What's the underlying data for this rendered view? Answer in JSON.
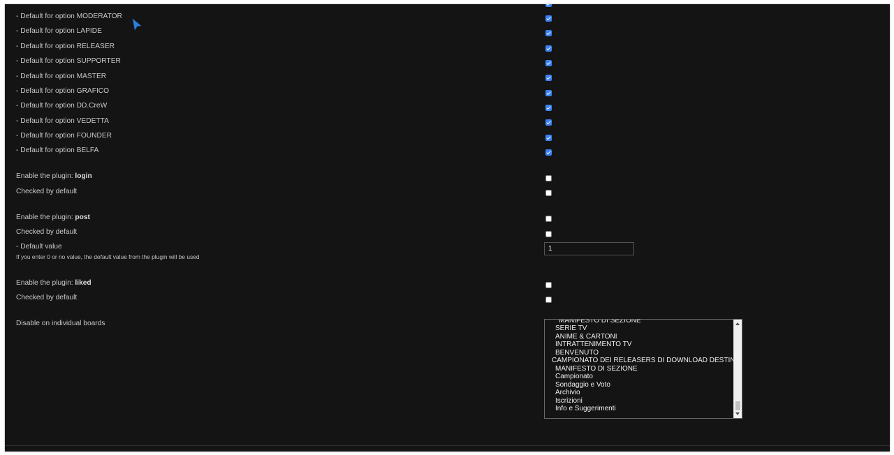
{
  "cursor_icon": "mouse-pointer-icon",
  "group_options": [
    {
      "label": "- Default for option MODERATOR",
      "checked": true
    },
    {
      "label": "- Default for option LAPIDE",
      "checked": true
    },
    {
      "label": "- Default for option RELEASER",
      "checked": true
    },
    {
      "label": "- Default for option SUPPORTER",
      "checked": true
    },
    {
      "label": "- Default for option MASTER",
      "checked": true
    },
    {
      "label": "- Default for option GRAFICO",
      "checked": true
    },
    {
      "label": "- Default for option DD.CreW",
      "checked": true
    },
    {
      "label": "- Default for option VEDETTA",
      "checked": true
    },
    {
      "label": "- Default for option FOUNDER",
      "checked": true
    },
    {
      "label": "- Default for option BELFA",
      "checked": true
    }
  ],
  "plugin_login": {
    "enable_prefix": "Enable the plugin: ",
    "name": "login",
    "enabled": false,
    "checked_label": "Checked by default",
    "checked_default": false
  },
  "plugin_post": {
    "enable_prefix": "Enable the plugin: ",
    "name": "post",
    "enabled": false,
    "checked_label": "Checked by default",
    "checked_default": false,
    "default_value_label": "- Default value",
    "default_value_hint": "If you enter 0 or no value, the default value from the plugin will be used",
    "default_value": "1"
  },
  "plugin_liked": {
    "enable_prefix": "Enable the plugin: ",
    "name": "liked",
    "enabled": false,
    "checked_label": "Checked by default",
    "checked_default": false
  },
  "disable_boards": {
    "label": "Disable on individual boards",
    "options": [
      {
        "text": "MANIFESTO DI SEZIONE",
        "level": "sub"
      },
      {
        "text": "SERIE TV",
        "level": "sub"
      },
      {
        "text": "ANIME & CARTONI",
        "level": "sub"
      },
      {
        "text": "INTRATTENIMENTO TV",
        "level": "sub"
      },
      {
        "text": "BENVENUTO",
        "level": "sub"
      },
      {
        "text": "CAMPIONATO DEI RELEASERS DI DOWNLOAD DESTINAT",
        "level": "cat"
      },
      {
        "text": "MANIFESTO DI SEZIONE",
        "level": "sub"
      },
      {
        "text": "Campionato",
        "level": "sub"
      },
      {
        "text": "Sondaggio e Voto",
        "level": "sub"
      },
      {
        "text": "Archivio",
        "level": "sub"
      },
      {
        "text": "Iscrizioni",
        "level": "sub"
      },
      {
        "text": "Info e Suggerimenti",
        "level": "sub"
      }
    ],
    "scrollbar_up_icon": "scroll-up-arrow-icon",
    "scrollbar_down_icon": "scroll-down-arrow-icon"
  },
  "colors": {
    "panel_bg": "#141414",
    "checkbox_checked": "#3b82f6",
    "text": "#c9c9c9"
  }
}
